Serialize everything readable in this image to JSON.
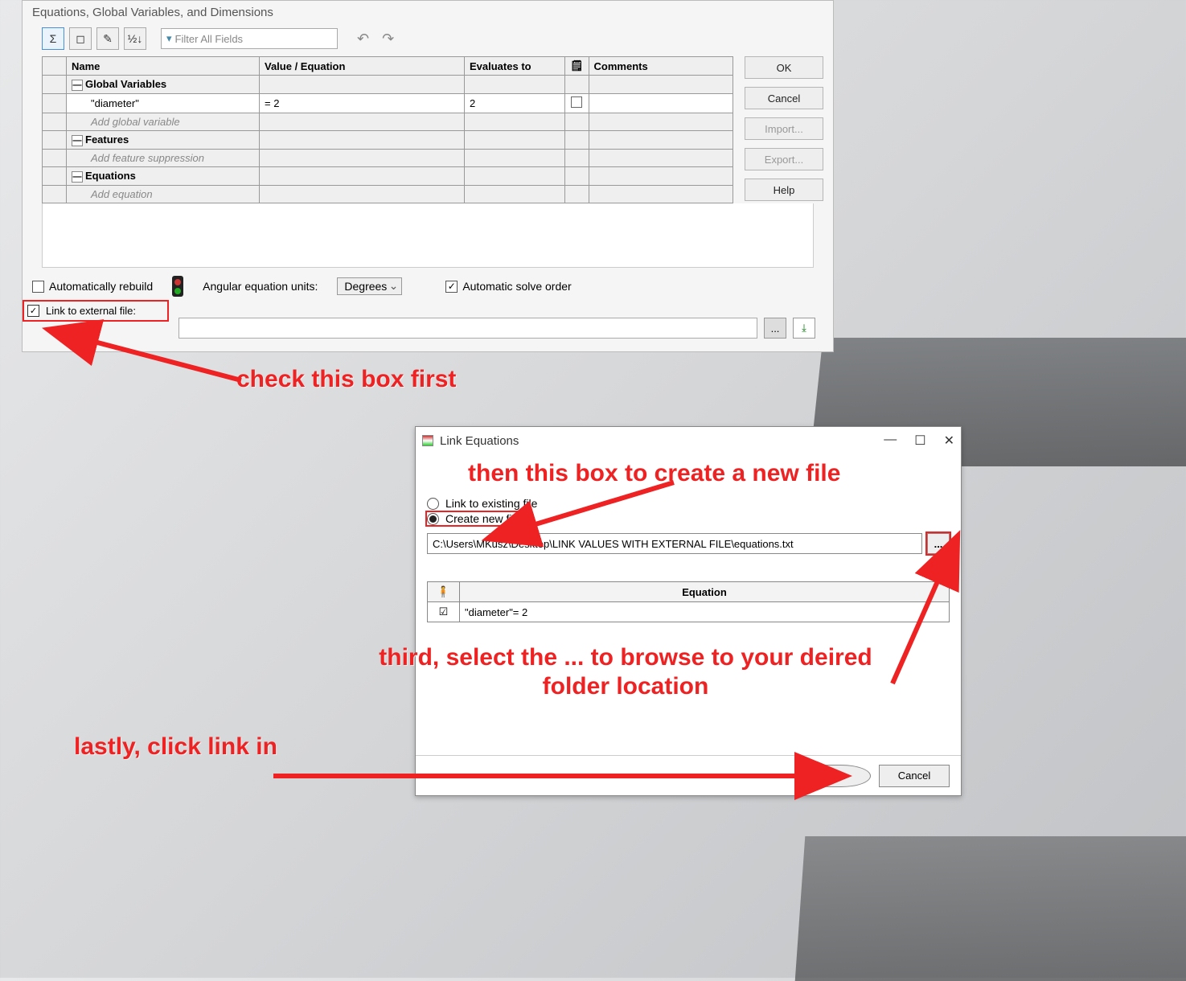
{
  "main_dialog": {
    "title": "Equations, Global Variables, and Dimensions",
    "filter_placeholder": "Filter All Fields",
    "columns": {
      "name": "Name",
      "value": "Value / Equation",
      "evaluates": "Evaluates to",
      "comments": "Comments"
    },
    "sections": {
      "global_vars": "Global Variables",
      "features": "Features",
      "equations": "Equations"
    },
    "hints": {
      "add_global": "Add global variable",
      "add_feature": "Add feature suppression",
      "add_equation": "Add equation"
    },
    "rows": [
      {
        "name": "\"diameter\"",
        "value": "= 2",
        "evaluates": "2"
      }
    ],
    "buttons": {
      "ok": "OK",
      "cancel": "Cancel",
      "import": "Import...",
      "export": "Export...",
      "help": "Help"
    },
    "footer": {
      "auto_rebuild": "Automatically rebuild",
      "angular_label": "Angular equation units:",
      "angular_value": "Degrees",
      "auto_solve": "Automatic solve order",
      "link_external": "Link to external file:",
      "browse": "..."
    }
  },
  "link_dialog": {
    "title": "Link Equations",
    "radio_existing": "Link to existing file",
    "radio_create": "Create new file",
    "path": "C:\\Users\\MKusz\\Desktop\\LINK VALUES WITH EXTERNAL FILE\\equations.txt",
    "browse": "...",
    "col_equation": "Equation",
    "row1": "\"diameter\"= 2",
    "btn_link": "Link",
    "btn_cancel": "Cancel"
  },
  "annotations": {
    "a1": "check this box first",
    "a2": "then this box to create a new file",
    "a3": "third, select the ... to browse to your deired folder location",
    "a4": "lastly, click link in"
  }
}
